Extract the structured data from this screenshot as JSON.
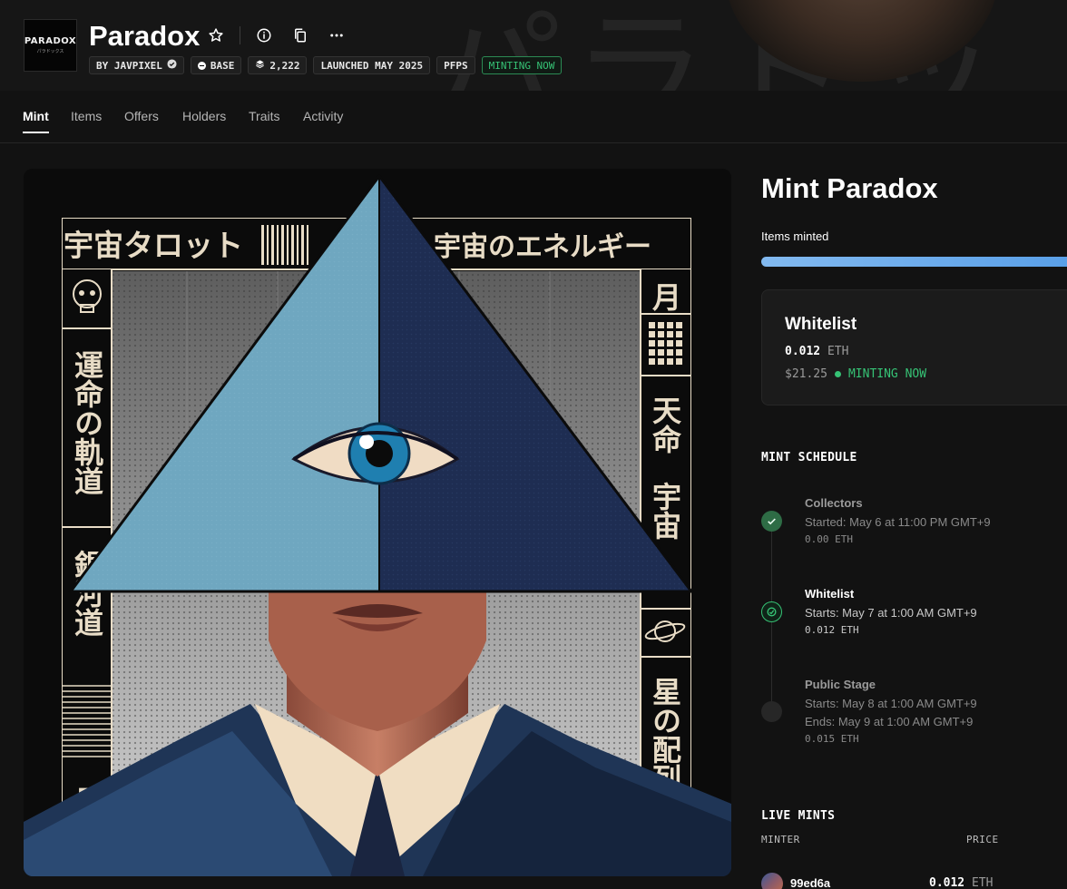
{
  "collection": {
    "logo_text": "PARADOX",
    "logo_subtext": "パラドックス",
    "name": "Paradox",
    "chips": [
      {
        "label": "BY JAVPIXEL",
        "icon": "verified-badge-icon"
      },
      {
        "label": "BASE",
        "icon": "base-chain-icon"
      },
      {
        "label": "2,222",
        "icon": "layers-icon"
      },
      {
        "label": "LAUNCHED MAY 2025"
      },
      {
        "label": "PFPS"
      },
      {
        "label": "MINTING NOW",
        "color": "#36c275"
      }
    ],
    "header_icons": [
      "star-icon",
      "info-icon",
      "copy-icon",
      "more-icon"
    ]
  },
  "tabs": [
    "Mint",
    "Items",
    "Offers",
    "Holders",
    "Traits",
    "Activity"
  ],
  "active_tab": "Mint",
  "artwork": {
    "panel_left_top": "宇宙タロット",
    "panel_right_top": "宇宙のエネルギー",
    "left_column_1": "運命の軌道",
    "left_column_2": "銀河道",
    "left_column_3": "日",
    "right_column_1": "月",
    "right_column_2": "天命",
    "right_column_3": "宇宙",
    "right_column_4": "星の配列"
  },
  "mint": {
    "title": "Mint Paradox",
    "items_minted_label": "Items minted",
    "progress_fraction": 1.0,
    "current_stage": {
      "name": "Whitelist",
      "price": "0.012",
      "currency": "ETH",
      "usd": "$21.25",
      "status": "MINTING NOW"
    },
    "schedule_title": "MINT SCHEDULE",
    "schedule": [
      {
        "name": "Collectors",
        "lines": [
          "Started: May 6 at 11:00 PM GMT+9"
        ],
        "price": "0.00 ETH",
        "state": "done"
      },
      {
        "name": "Whitelist",
        "lines": [
          "Starts: May 7 at 1:00 AM GMT+9"
        ],
        "price": "0.012 ETH",
        "state": "active"
      },
      {
        "name": "Public Stage",
        "lines": [
          "Starts: May 8 at 1:00 AM GMT+9",
          "Ends: May 9 at 1:00 AM GMT+9"
        ],
        "price": "0.015 ETH",
        "state": "pending"
      }
    ],
    "live_mints_title": "LIVE MINTS",
    "live_mints_columns": [
      "MINTER",
      "PRICE"
    ],
    "live_mints": [
      {
        "minter": "99ed6a",
        "price": "0.012",
        "currency": "ETH"
      }
    ]
  },
  "colors": {
    "background": "#121212",
    "accent_green": "#36c275",
    "progress_blue": "#6aaaea"
  }
}
